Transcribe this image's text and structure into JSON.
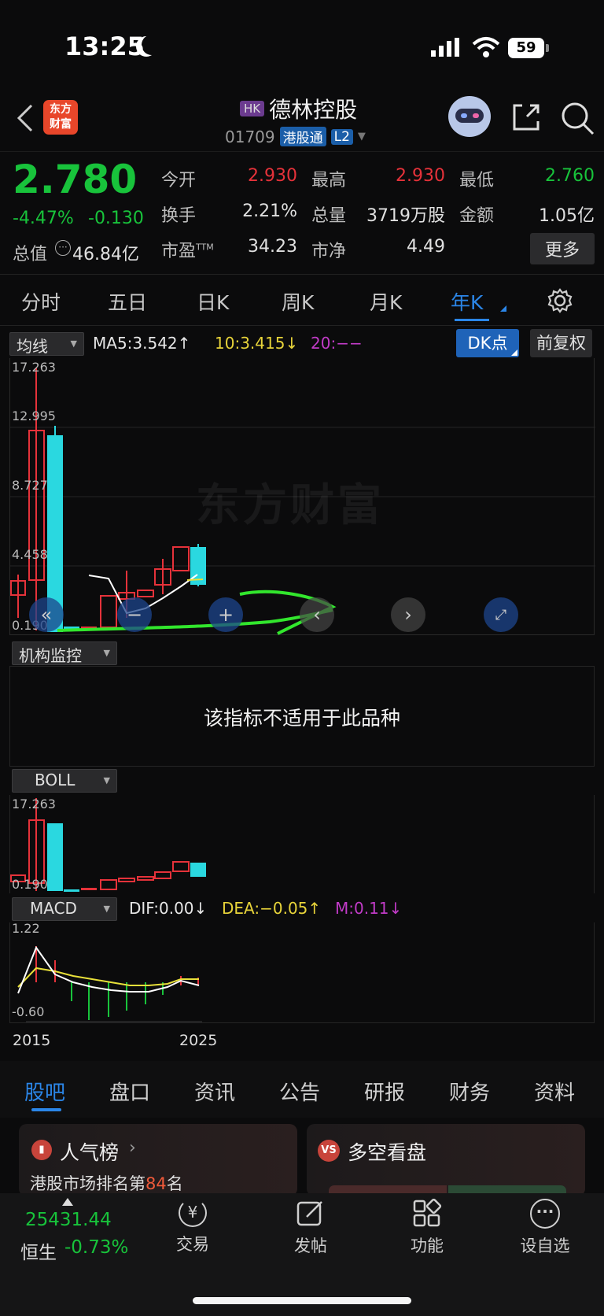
{
  "status_bar": {
    "time": "13:25",
    "battery": "59"
  },
  "header": {
    "logo_line1": "东方",
    "logo_line2": "财富",
    "market_badge": "HK",
    "stock_name": "德林控股",
    "stock_code": "01709",
    "channel_tag": "港股通",
    "level_tag": "L2"
  },
  "quote": {
    "price": "2.780",
    "change_pct": "-4.47%",
    "change": "-0.130",
    "open_label": "今开",
    "open": "2.930",
    "high_label": "最高",
    "high": "2.930",
    "low_label": "最低",
    "low": "2.760",
    "turnover_label": "换手",
    "turnover": "2.21%",
    "volume_label": "总量",
    "volume": "3719万股",
    "amount_label": "金额",
    "amount": "1.05亿",
    "mcap_label": "总值",
    "mcap": "46.84亿",
    "pe_label": "市盈",
    "pe_sup": "TTM",
    "pe": "34.23",
    "pb_label": "市净",
    "pb": "4.49",
    "more_button": "更多"
  },
  "kline_tabs": [
    "分时",
    "五日",
    "日K",
    "周K",
    "月K",
    "年K"
  ],
  "active_tab": "年K",
  "ma_bar": {
    "indicator": "均线",
    "ma5": "MA5:3.542↑",
    "ma10": "10:3.415↓",
    "ma20": "20:−−",
    "dk_button": "DK点",
    "adjust_button": "前复权"
  },
  "main_chart": {
    "y_labels": [
      "17.263",
      "12.995",
      "8.727",
      "4.458",
      "0.190"
    ],
    "watermark": "东方财富"
  },
  "inst_panel": {
    "dropdown": "机构监控",
    "message": "该指标不适用于此品种"
  },
  "boll_panel": {
    "dropdown": "BOLL",
    "y_top": "17.263",
    "y_bottom": "0.190"
  },
  "macd_panel": {
    "dropdown": "MACD",
    "dif": "DIF:0.00↓",
    "dea": "DEA:−0.05↑",
    "m": "M:0.11↓",
    "y_top": "1.22",
    "y_bottom": "-0.60",
    "x_start": "2015",
    "x_end": "2025"
  },
  "colors": {
    "up": "#e5323a",
    "down": "#2ad8e0",
    "price_green": "#18c33b",
    "accent_blue": "#2b7fe0"
  },
  "content_tabs": [
    "股吧",
    "盘口",
    "资讯",
    "公告",
    "研报",
    "财务",
    "资料"
  ],
  "active_content_tab": "股吧",
  "cards": {
    "popularity_title": "人气榜",
    "popularity_text_prefix": "港股市场排名第",
    "popularity_rank": "84",
    "popularity_text_suffix": "名",
    "bullbear_title": "多空看盘"
  },
  "bottom_nav": {
    "index_value": "25431.44",
    "index_name": "恒生",
    "index_change": "-0.73%",
    "trade": "交易",
    "post": "发帖",
    "functions": "功能",
    "watchlist": "设自选"
  }
}
